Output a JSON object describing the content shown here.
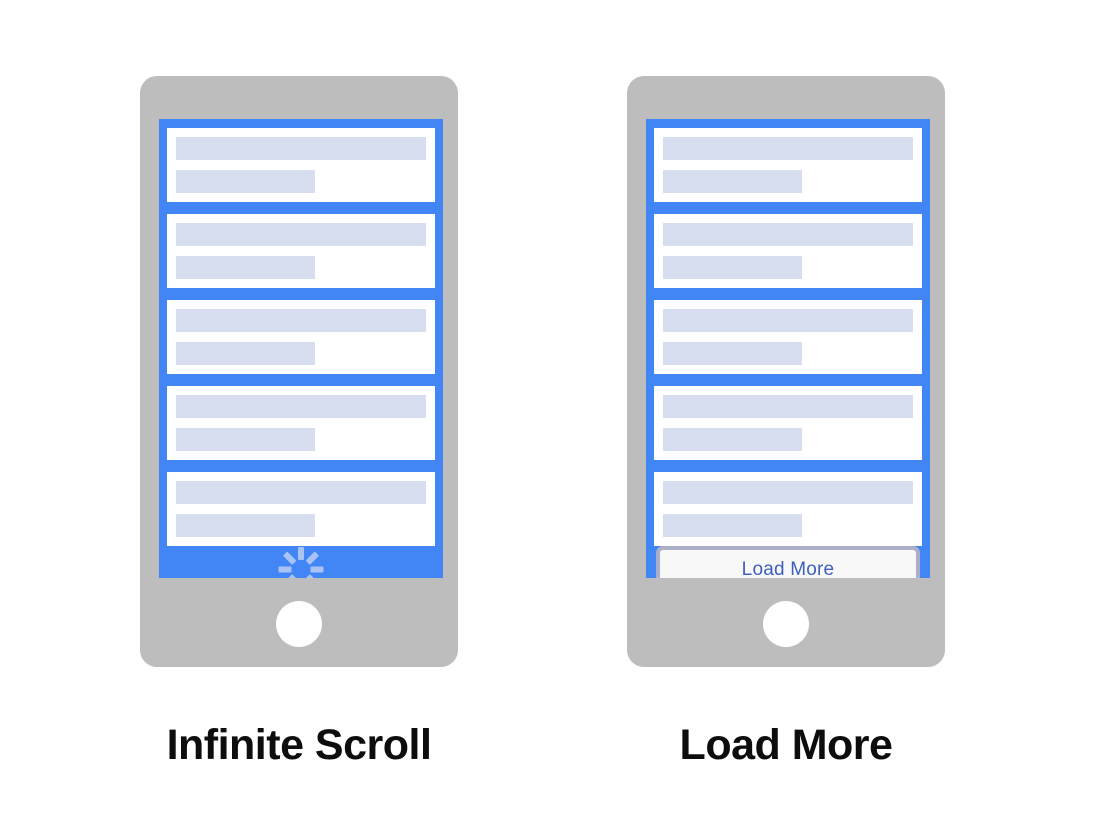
{
  "palette": {
    "background": "#ffffff",
    "phone_body": "#bdbdbd",
    "screen_blue": "#4285f4",
    "card_white": "#ffffff",
    "placeholder_bar": "#d6def0",
    "spinner": "#a9c3f5",
    "button_fill": "#f8f8f8",
    "button_border": "#adaec8",
    "button_text": "#3f5fbf",
    "caption_text": "#0d0d0d"
  },
  "panels": [
    {
      "id": "infinite-scroll",
      "caption": "Infinite Scroll",
      "cards": [
        {
          "title_width": "100%",
          "subtitle_width": "55.5%"
        },
        {
          "title_width": "100%",
          "subtitle_width": "55.5%"
        },
        {
          "title_width": "100%",
          "subtitle_width": "55.5%"
        },
        {
          "title_width": "100%",
          "subtitle_width": "55.5%"
        },
        {
          "title_width": "100%",
          "subtitle_width": "55.5%"
        }
      ],
      "footer": {
        "type": "spinner",
        "icon": "loading-spinner-icon",
        "spokes": 8,
        "label": ""
      }
    },
    {
      "id": "load-more",
      "caption": "Load More",
      "cards": [
        {
          "title_width": "100%",
          "subtitle_width": "55.5%"
        },
        {
          "title_width": "100%",
          "subtitle_width": "55.5%"
        },
        {
          "title_width": "100%",
          "subtitle_width": "55.5%"
        },
        {
          "title_width": "100%",
          "subtitle_width": "55.5%"
        },
        {
          "title_width": "100%",
          "subtitle_width": "55.5%"
        }
      ],
      "footer": {
        "type": "button",
        "icon": "",
        "spokes": 0,
        "label": "Load More"
      }
    }
  ]
}
